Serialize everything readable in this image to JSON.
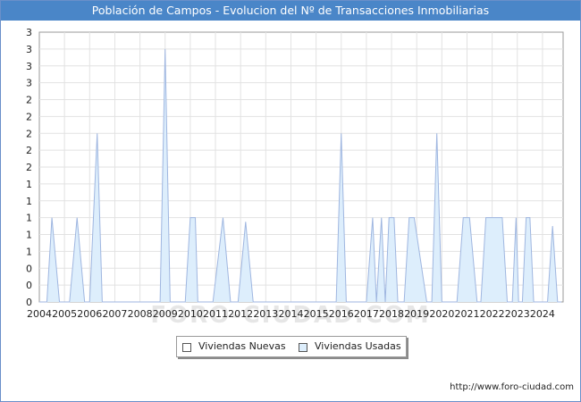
{
  "chart_data": {
    "type": "area",
    "title": "Población de Campos - Evolucion del Nº de Transacciones Inmobiliarias",
    "xlabel": "",
    "ylabel": "",
    "x_tick_labels": [
      "2004",
      "2005",
      "2006",
      "2007",
      "2008",
      "2009",
      "2010",
      "2011",
      "2012",
      "2013",
      "2014",
      "2015",
      "2016",
      "2017",
      "2018",
      "2019",
      "2020",
      "2021",
      "2022",
      "2023",
      "2024"
    ],
    "y_tick_labels": [
      "0",
      "0",
      "0",
      "1",
      "1",
      "1",
      "1",
      "1",
      "2",
      "2",
      "2",
      "2",
      "2",
      "3",
      "3",
      "3",
      "3"
    ],
    "ylim": [
      0,
      3.2
    ],
    "grid": true,
    "legend_position": "bottom",
    "series": [
      {
        "name": "Viviendas Nuevas",
        "color": "#ffffff",
        "stroke": "#aaaaaa",
        "x": [
          2004.0,
          2024.75
        ],
        "values": [
          0,
          0
        ]
      },
      {
        "name": "Viviendas Usadas",
        "color": "#ddeefc",
        "stroke": "#9fb6e0",
        "x": [
          2004.0,
          2004.3,
          2004.5,
          2004.8,
          2005.2,
          2005.5,
          2005.8,
          2006.0,
          2006.3,
          2006.5,
          2006.8,
          2007.0,
          2008.5,
          2008.8,
          2009.0,
          2009.2,
          2009.5,
          2009.8,
          2010.0,
          2010.2,
          2010.3,
          2010.8,
          2010.9,
          2011.3,
          2011.6,
          2011.9,
          2012.2,
          2012.5,
          2015.5,
          2015.8,
          2016.0,
          2016.2,
          2016.5,
          2017.0,
          2017.25,
          2017.4,
          2017.6,
          2017.75,
          2017.9,
          2018.1,
          2018.25,
          2018.5,
          2018.7,
          2018.9,
          2019.4,
          2019.6,
          2019.8,
          2020.0,
          2020.2,
          2020.6,
          2020.85,
          2021.1,
          2021.4,
          2021.55,
          2021.75,
          2022.4,
          2022.6,
          2022.8,
          2022.95,
          2023.05,
          2023.2,
          2023.35,
          2023.5,
          2023.65,
          2023.8,
          2024.0,
          2024.2,
          2024.4,
          2024.6,
          2024.75
        ],
        "values": [
          0,
          0,
          1,
          0,
          0,
          1,
          0,
          0,
          2,
          0,
          0,
          0,
          0,
          0,
          3,
          0,
          0,
          0,
          1,
          1,
          0,
          0,
          0,
          1,
          0,
          0,
          0.95,
          0,
          0,
          0,
          2,
          0,
          0,
          0,
          1,
          0,
          1,
          0,
          1,
          1,
          0,
          0,
          1,
          1,
          0,
          0,
          2,
          0,
          0,
          0,
          1,
          1,
          0,
          0,
          1,
          1,
          0,
          0,
          1,
          0,
          0,
          1,
          1,
          0,
          0,
          0,
          0,
          0.9,
          0,
          0
        ]
      }
    ]
  },
  "legend": {
    "nuevas_label": "Viviendas Nuevas",
    "usadas_label": "Viviendas Usadas"
  },
  "watermark_text": "FORO-CIUDAD.COM",
  "footer_url": "http://www.foro-ciudad.com"
}
